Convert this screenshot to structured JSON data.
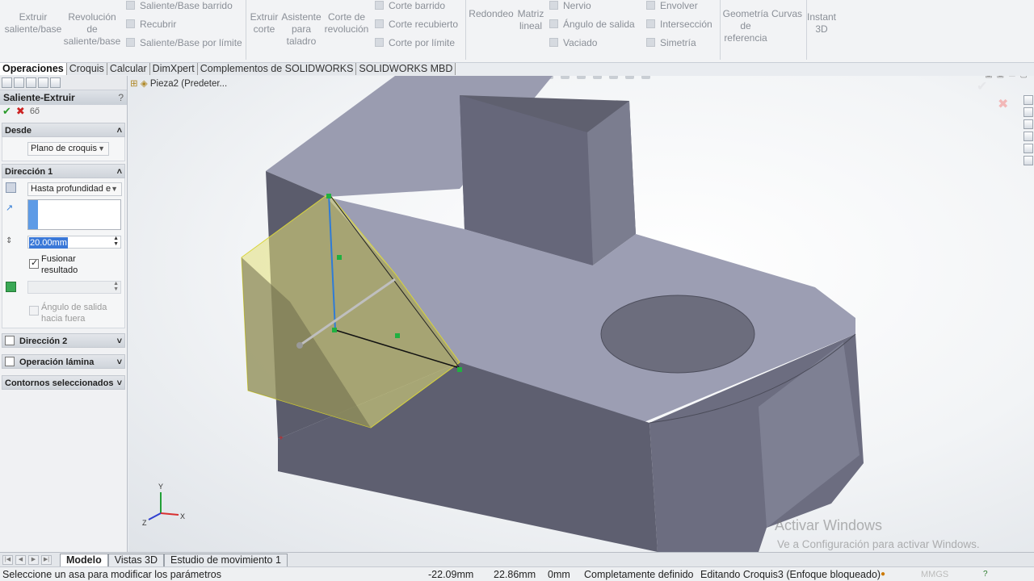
{
  "ribbon": {
    "big": [
      {
        "id": "extruir-saliente",
        "label": "Extruir\nsaliente/base"
      },
      {
        "id": "revolucion",
        "label": "Revolución\nde\nsaliente/base"
      },
      {
        "id": "extruir-corte",
        "label": "Extruir\ncorte"
      },
      {
        "id": "asistente-taladro",
        "label": "Asistente\npara\ntaladro"
      },
      {
        "id": "corte-revolucion",
        "label": "Corte de\nrevolución"
      },
      {
        "id": "redondeo",
        "label": "Redondeo"
      },
      {
        "id": "matriz-lineal",
        "label": "Matriz\nlineal"
      },
      {
        "id": "geometria-referencia",
        "label": "Geometría\nde\nreferencia"
      },
      {
        "id": "curvas",
        "label": "Curvas"
      },
      {
        "id": "instant3d",
        "label": "Instant\n3D"
      }
    ],
    "small": {
      "saliente_barrido": "Saliente/Base barrido",
      "recubrir": "Recubrir",
      "saliente_limite": "Saliente/Base por límite",
      "corte_barrido": "Corte barrido",
      "corte_recubierto": "Corte recubierto",
      "corte_limite": "Corte por límite",
      "nervio": "Nervio",
      "angulo_salida": "Ángulo de salida",
      "vaciado": "Vaciado",
      "envolver": "Envolver",
      "interseccion": "Intersección",
      "simetria": "Simetría"
    }
  },
  "command_tabs": [
    "Operaciones",
    "Croquis",
    "Calcular",
    "DimXpert",
    "Complementos de SOLIDWORKS",
    "SOLIDWORKS MBD"
  ],
  "property_manager": {
    "title": "Saliente-Extruir",
    "help": "?",
    "ok": "✔",
    "cancel": "✖",
    "desde": {
      "header": "Desde",
      "value": "Plano de croquis"
    },
    "direccion1": {
      "header": "Dirección 1",
      "end_condition": "Hasta profundidad e",
      "depth": "20.00mm",
      "fusionar": "Fusionar\nresultado",
      "fusionar_checked": true,
      "angulo": "Ángulo de salida\nhacia fuera",
      "angulo_checked": false
    },
    "direccion2": "Dirección 2",
    "operacion_lamina": "Operación lámina",
    "contornos": "Contornos seleccionados"
  },
  "viewport": {
    "breadcrumb": "Pieza2  (Predeter...",
    "watermark_title": "Activar Windows",
    "watermark_sub": "Ve a Configuración para activar Windows.",
    "triad": {
      "x": "X",
      "y": "Y",
      "z": "Z"
    }
  },
  "bottom_tabs": [
    "Modelo",
    "Vistas 3D",
    "Estudio de movimiento 1"
  ],
  "status": {
    "message": "Seleccione un asa para modificar los parámetros",
    "x": "-22.09mm",
    "y": "22.86mm",
    "z": "0mm",
    "sketch_state": "Completamente definido",
    "editing": "Editando Croquis3 (Enfoque bloqueado)",
    "units": "MMGS"
  },
  "colors": {
    "part_face": "#8b8d9e",
    "part_top": "#9fa1b4",
    "preview": "#e3e07a",
    "accent_blue": "#2f7bd6"
  }
}
